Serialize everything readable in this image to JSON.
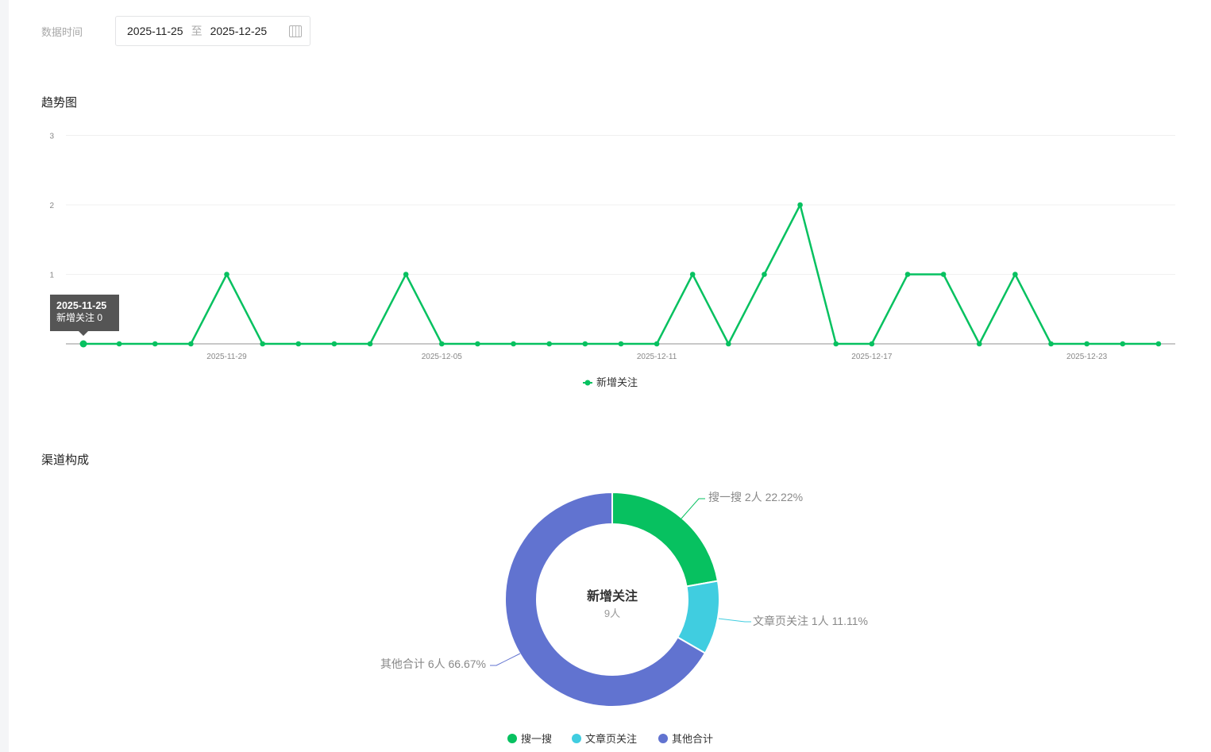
{
  "filter": {
    "label": "数据时间",
    "start": "2025-11-25",
    "separator": "至",
    "end": "2025-12-25",
    "icon": "calendar-icon"
  },
  "trend": {
    "title": "趋势图",
    "tooltip": {
      "date": "2025-11-25",
      "text": "新增关注 0"
    }
  },
  "channel": {
    "title": "渠道构成",
    "center_title": "新增关注",
    "center_value": "9人"
  },
  "chart_data": [
    {
      "type": "line",
      "title": "趋势图",
      "ylim": [
        0,
        3
      ],
      "yticks": [
        "1",
        "2",
        "3"
      ],
      "x": [
        "2025-11-25",
        "2025-11-26",
        "2025-11-27",
        "2025-11-28",
        "2025-11-29",
        "2025-11-30",
        "2025-12-01",
        "2025-12-02",
        "2025-12-03",
        "2025-12-04",
        "2025-12-05",
        "2025-12-06",
        "2025-12-07",
        "2025-12-08",
        "2025-12-09",
        "2025-12-10",
        "2025-12-11",
        "2025-12-12",
        "2025-12-13",
        "2025-12-14",
        "2025-12-15",
        "2025-12-16",
        "2025-12-17",
        "2025-12-18",
        "2025-12-19",
        "2025-12-20",
        "2025-12-21",
        "2025-12-22",
        "2025-12-23",
        "2025-12-24",
        "2025-12-25"
      ],
      "xticks": [
        "2025-11-29",
        "2025-12-05",
        "2025-12-11",
        "2025-12-17",
        "2025-12-23"
      ],
      "series": [
        {
          "name": "新增关注",
          "color": "#07c160",
          "values": [
            0,
            0,
            0,
            0,
            1,
            0,
            0,
            0,
            0,
            1,
            0,
            0,
            0,
            0,
            0,
            0,
            0,
            1,
            0,
            1,
            2,
            0,
            0,
            1,
            1,
            0,
            1,
            0,
            0,
            0,
            0
          ]
        }
      ],
      "legend": "bottom"
    },
    {
      "type": "pie",
      "title": "渠道构成",
      "slices": [
        {
          "name": "搜一搜",
          "value": 2,
          "label": "搜一搜 2人 22.22%",
          "color": "#07c160"
        },
        {
          "name": "文章页关注",
          "value": 1,
          "label": "文章页关注 1人 11.11%",
          "color": "#40cde0"
        },
        {
          "name": "其他合计",
          "value": 6,
          "label": "其他合计 6人 66.67%",
          "color": "#6173d0"
        }
      ],
      "legend": "bottom"
    }
  ]
}
